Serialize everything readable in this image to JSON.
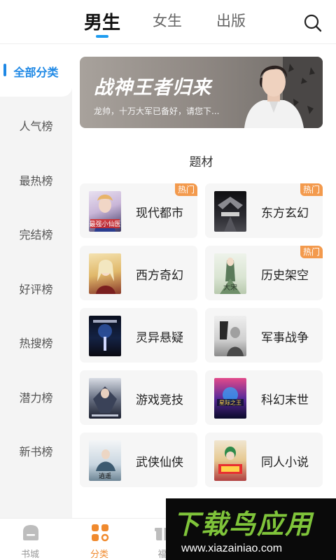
{
  "header": {
    "tabs": [
      {
        "label": "男生",
        "active": true
      },
      {
        "label": "女生",
        "active": false
      },
      {
        "label": "出版",
        "active": false
      }
    ],
    "search_icon": "search-icon",
    "accent_color": "#1e9cf0"
  },
  "sidebar": {
    "items": [
      {
        "label": "全部分类",
        "active": true
      },
      {
        "label": "人气榜",
        "active": false
      },
      {
        "label": "最热榜",
        "active": false
      },
      {
        "label": "完结榜",
        "active": false
      },
      {
        "label": "好评榜",
        "active": false
      },
      {
        "label": "热搜榜",
        "active": false
      },
      {
        "label": "潜力榜",
        "active": false
      },
      {
        "label": "新书榜",
        "active": false
      }
    ]
  },
  "banner": {
    "title": "战神王者归来",
    "subtitle": "龙帅，十万大军已备好，请您下..."
  },
  "section": {
    "title": "题材"
  },
  "categories": [
    {
      "label": "现代都市",
      "badge": "热门",
      "cover_text": "最强小仙医"
    },
    {
      "label": "东方玄幻",
      "badge": "热门",
      "cover_text": ""
    },
    {
      "label": "西方奇幻",
      "badge": "",
      "cover_text": ""
    },
    {
      "label": "历史架空",
      "badge": "热门",
      "cover_text": "大宋"
    },
    {
      "label": "灵异悬疑",
      "badge": "",
      "cover_text": ""
    },
    {
      "label": "军事战争",
      "badge": "",
      "cover_text": ""
    },
    {
      "label": "游戏竞技",
      "badge": "",
      "cover_text": ""
    },
    {
      "label": "科幻末世",
      "badge": "",
      "cover_text": "星际之王"
    },
    {
      "label": "武侠仙侠",
      "badge": "",
      "cover_text": "逍遥"
    },
    {
      "label": "同人小说",
      "badge": "",
      "cover_text": ""
    }
  ],
  "bottom_nav": [
    {
      "label": "书城",
      "icon": "bookstore-icon",
      "active": false
    },
    {
      "label": "分类",
      "icon": "category-grid-icon",
      "active": true
    },
    {
      "label": "福",
      "icon": "gift-icon",
      "active": false
    }
  ],
  "watermark": {
    "title": "下载鸟应用",
    "url": "www.xiazainiao.com"
  },
  "colors": {
    "nav_active": "#f08a2e",
    "hot_badge": "#f39a4d",
    "sidebar_active": "#1e88e5"
  }
}
